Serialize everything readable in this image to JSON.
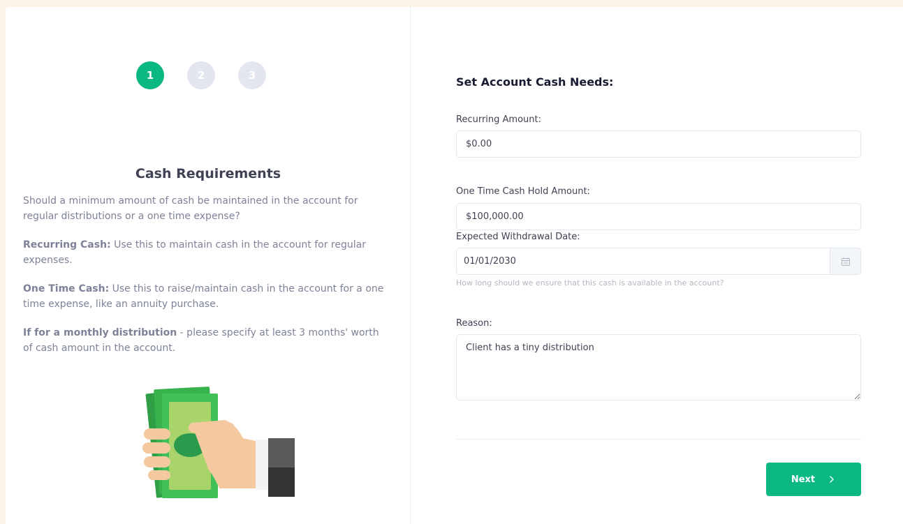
{
  "stepper": {
    "steps": [
      "1",
      "2",
      "3"
    ],
    "active_step": "1"
  },
  "left_panel": {
    "title": "Cash Requirements",
    "intro": "Should a minimum amount of cash be maintained in the account for regular distributions or a one time expense?",
    "recurring_label": "Recurring Cash:",
    "recurring_text": " Use this to maintain cash in the account for regular expenses.",
    "one_time_label": "One Time Cash:",
    "one_time_text": " Use this to raise/maintain cash in the account for a one time expense, like an annuity purchase.",
    "monthly_label": "If for a monthly distribution",
    "monthly_text": " - please specify at least 3 months' worth of cash amount in the account.",
    "illustration_icon": "hand-holding-cash-icon"
  },
  "form": {
    "title": "Set Account Cash Needs:",
    "recurring_amount_label": "Recurring Amount:",
    "recurring_amount_value": "$0.00",
    "one_time_label": "One Time Cash Hold Amount:",
    "one_time_value": "$100,000.00",
    "withdrawal_date_label": "Expected Withdrawal Date:",
    "withdrawal_date_value": "01/01/2030",
    "withdrawal_hint": "How long should we ensure that this cash is available in the account?",
    "calendar_icon": "calendar-icon",
    "reason_label": "Reason:",
    "reason_value": "Client has a tiny distribution",
    "next_label": "Next",
    "next_icon": "chevron-right-icon"
  },
  "colors": {
    "accent": "#0bb783",
    "background": "#faf3e6",
    "inactive_step": "#e4e6ef"
  }
}
